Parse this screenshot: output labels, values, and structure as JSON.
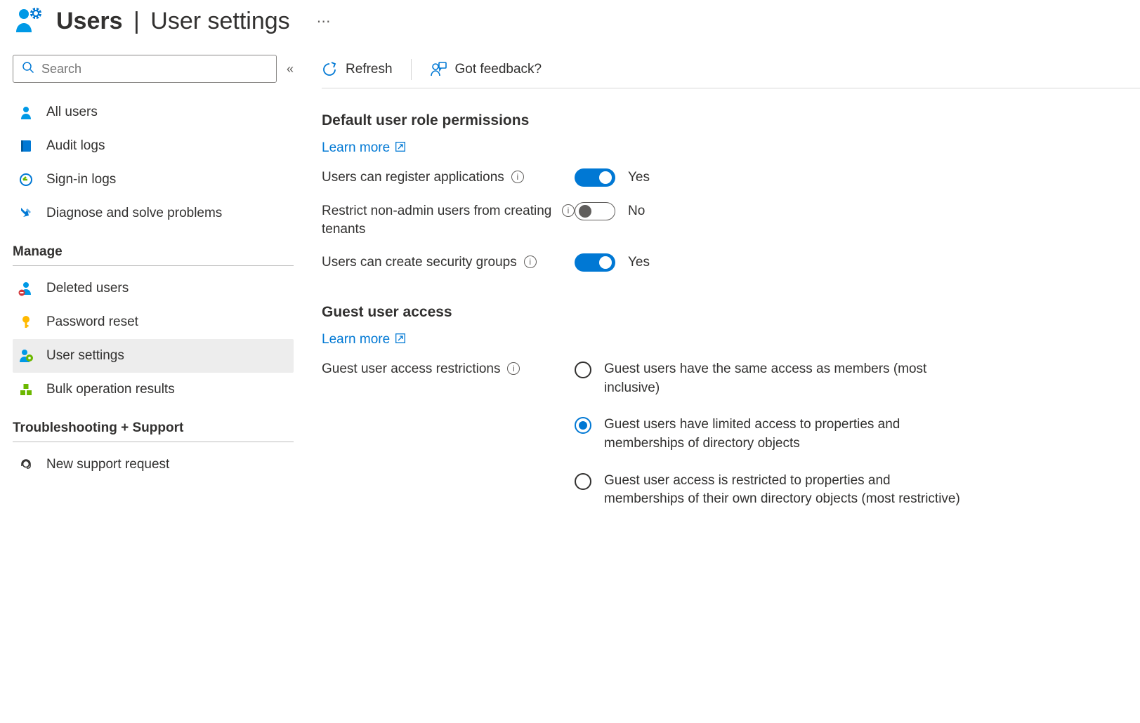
{
  "header": {
    "title_bold": "Users",
    "title_rest": "User settings"
  },
  "sidebar": {
    "search_placeholder": "Search",
    "items_top": [
      {
        "label": "All users"
      },
      {
        "label": "Audit logs"
      },
      {
        "label": "Sign-in logs"
      },
      {
        "label": "Diagnose and solve problems"
      }
    ],
    "section_manage": "Manage",
    "items_manage": [
      {
        "label": "Deleted users"
      },
      {
        "label": "Password reset"
      },
      {
        "label": "User settings",
        "selected": true
      },
      {
        "label": "Bulk operation results"
      }
    ],
    "section_support": "Troubleshooting + Support",
    "items_support": [
      {
        "label": "New support request"
      }
    ]
  },
  "toolbar": {
    "refresh_label": "Refresh",
    "feedback_label": "Got feedback?"
  },
  "sections": {
    "default_role": {
      "title": "Default user role permissions",
      "learn_more": "Learn more",
      "settings": [
        {
          "label": "Users can register applications",
          "value": true,
          "text": "Yes"
        },
        {
          "label": "Restrict non-admin users from creating tenants",
          "value": false,
          "text": "No"
        },
        {
          "label": "Users can create security groups",
          "value": true,
          "text": "Yes"
        }
      ]
    },
    "guest_access": {
      "title": "Guest user access",
      "learn_more": "Learn more",
      "restrictions_label": "Guest user access restrictions",
      "options": [
        {
          "label": "Guest users have the same access as members (most inclusive)",
          "selected": false
        },
        {
          "label": "Guest users have limited access to properties and memberships of directory objects",
          "selected": true
        },
        {
          "label": "Guest user access is restricted to properties and memberships of their own directory objects (most restrictive)",
          "selected": false
        }
      ]
    }
  }
}
